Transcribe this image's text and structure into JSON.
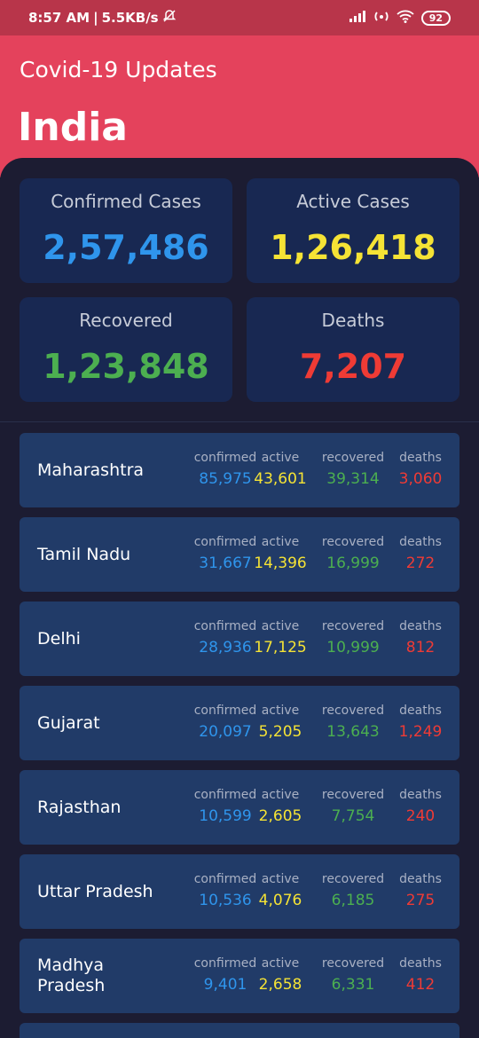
{
  "status_bar": {
    "time": "8:57 AM",
    "speed": "5.5KB/s",
    "battery": "92"
  },
  "header": {
    "app_title": "Covid-19 Updates",
    "country": "India"
  },
  "summary": {
    "confirmed": {
      "label": "Confirmed Cases",
      "value": "2,57,486"
    },
    "active": {
      "label": "Active Cases",
      "value": "1,26,418"
    },
    "recovered": {
      "label": "Recovered",
      "value": "1,23,848"
    },
    "deaths": {
      "label": "Deaths",
      "value": "7,207"
    }
  },
  "column_labels": {
    "confirmed": "confirmed",
    "active": "active",
    "recovered": "recovered",
    "deaths": "deaths"
  },
  "colors": {
    "header": "#e4425c",
    "confirmed": "#2f95ec",
    "active": "#f5e335",
    "recovered": "#4caf50",
    "deaths": "#ef3b35"
  },
  "states": [
    {
      "name": "Maharashtra",
      "confirmed": "85,975",
      "active": "43,601",
      "recovered": "39,314",
      "deaths": "3,060"
    },
    {
      "name": "Tamil Nadu",
      "confirmed": "31,667",
      "active": "14,396",
      "recovered": "16,999",
      "deaths": "272"
    },
    {
      "name": "Delhi",
      "confirmed": "28,936",
      "active": "17,125",
      "recovered": "10,999",
      "deaths": "812"
    },
    {
      "name": "Gujarat",
      "confirmed": "20,097",
      "active": "5,205",
      "recovered": "13,643",
      "deaths": "1,249"
    },
    {
      "name": "Rajasthan",
      "confirmed": "10,599",
      "active": "2,605",
      "recovered": "7,754",
      "deaths": "240"
    },
    {
      "name": "Uttar Pradesh",
      "confirmed": "10,536",
      "active": "4,076",
      "recovered": "6,185",
      "deaths": "275"
    },
    {
      "name": "Madhya Pradesh",
      "confirmed": "9,401",
      "active": "2,658",
      "recovered": "6,331",
      "deaths": "412"
    }
  ]
}
